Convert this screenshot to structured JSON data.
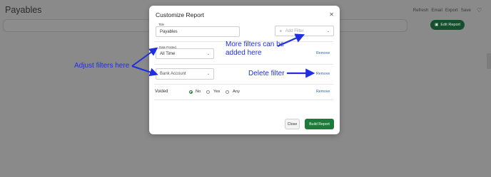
{
  "background": {
    "page_title": "Payables",
    "top_actions": [
      "Refresh",
      "Email",
      "Export",
      "Save"
    ],
    "edit_report_label": "Edit Report"
  },
  "modal": {
    "title": "Customize Report",
    "title_field": {
      "label": "Title",
      "value": "Payables"
    },
    "add_filter_placeholder": "Add Filter",
    "date_posted": {
      "label": "Date Posted",
      "value": "All Time",
      "remove": "Remove"
    },
    "bank_account": {
      "placeholder": "Bank Account",
      "remove": "Remove"
    },
    "voided": {
      "label": "Voided",
      "options": [
        "No",
        "Yes",
        "Any"
      ],
      "selected": "No",
      "remove": "Remove"
    },
    "close_label": "Close",
    "build_label": "Build Report"
  },
  "annotations": {
    "more_filters": "More filters can be added here",
    "adjust_filters": "Adjust filters here",
    "delete_filter": "Delete filter"
  },
  "colors": {
    "accent_green": "#1c7a3a",
    "annotation_blue": "#1f2fe0",
    "link_blue": "#2f67b6"
  }
}
